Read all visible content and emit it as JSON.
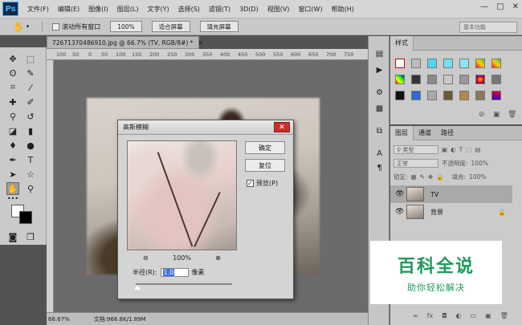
{
  "app": {
    "logo": "Ps"
  },
  "menu": [
    "文件(F)",
    "编辑(E)",
    "图像(I)",
    "图层(L)",
    "文字(Y)",
    "选择(S)",
    "滤镜(T)",
    "3D(D)",
    "视图(V)",
    "窗口(W)",
    "帮助(H)"
  ],
  "window_controls": {
    "minimize": "—",
    "maximize": "□",
    "close": "✕"
  },
  "options": {
    "scroll_all": "滚动所有窗口",
    "zoom_100": "100%",
    "fit_screen": "适合屏幕",
    "fill_screen": "填充屏幕",
    "workspace": "基本功能"
  },
  "document": {
    "tab_title": "72671370486910.jpg @ 66.7% (TV, RGB/8#) *",
    "zoom": "66.67%",
    "doc_size": "文档:966.8K/1.89M",
    "ruler_ticks": [
      "100",
      "50",
      "0",
      "50",
      "100",
      "150",
      "200",
      "250",
      "300",
      "350",
      "400",
      "450",
      "500",
      "550",
      "600",
      "650",
      "700",
      "750"
    ]
  },
  "dialog": {
    "title": "高斯模糊",
    "ok": "确定",
    "reset": "复位",
    "preview_label": "预览(P)",
    "preview_checked": true,
    "zoom_out": "⊖",
    "zoom_in": "⊕",
    "zoom_level": "100%",
    "radius_label": "半径(R):",
    "radius_value": "1.0",
    "radius_unit": "像素"
  },
  "styles_panel": {
    "tab": "样式"
  },
  "layers_panel": {
    "tabs": [
      "图层",
      "通道",
      "路径"
    ],
    "filter_label": "类型",
    "blend_mode": "正常",
    "opacity_label": "不透明度:",
    "opacity_value": "100%",
    "lock_label": "锁定:",
    "fill_label": "填充:",
    "fill_value": "100%",
    "layers": [
      {
        "name": "TV",
        "selected": true
      },
      {
        "name": "背景",
        "selected": false
      }
    ]
  },
  "watermark": {
    "title": "百科全说",
    "subtitle": "助你轻松解决"
  },
  "colors": {
    "accent_green": "#1d9b5a",
    "close_red": "#c9302c",
    "selection_blue": "#3874d8"
  }
}
